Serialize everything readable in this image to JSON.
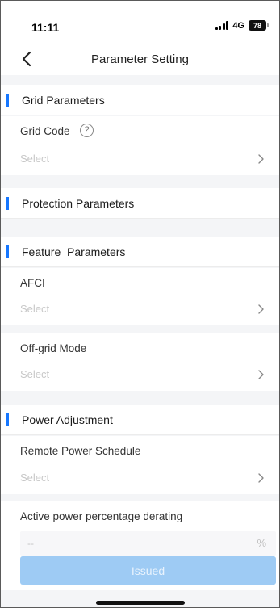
{
  "status_bar": {
    "time": "11:11",
    "network": "4G",
    "battery": "78"
  },
  "nav": {
    "title": "Parameter Setting",
    "back_icon": "chevron-left-icon"
  },
  "sections": {
    "grid": {
      "title": "Grid Parameters",
      "grid_code_label": "Grid Code",
      "grid_code_help": "?",
      "grid_code_placeholder": "Select"
    },
    "protection": {
      "title": "Protection Parameters"
    },
    "feature": {
      "title": "Feature_Parameters",
      "afci_label": "AFCI",
      "afci_placeholder": "Select",
      "offgrid_label": "Off-grid Mode",
      "offgrid_placeholder": "Select"
    },
    "power": {
      "title": "Power Adjustment",
      "schedule_label": "Remote Power Schedule",
      "schedule_placeholder": "Select",
      "derating_label": "Active power percentage derating",
      "derating_value": "--",
      "derating_unit": "%"
    }
  },
  "actions": {
    "issued_label": "Issued"
  },
  "colors": {
    "accent": "#1677ff",
    "button_disabled": "#9ecbf4",
    "background": "#f4f5f7"
  }
}
